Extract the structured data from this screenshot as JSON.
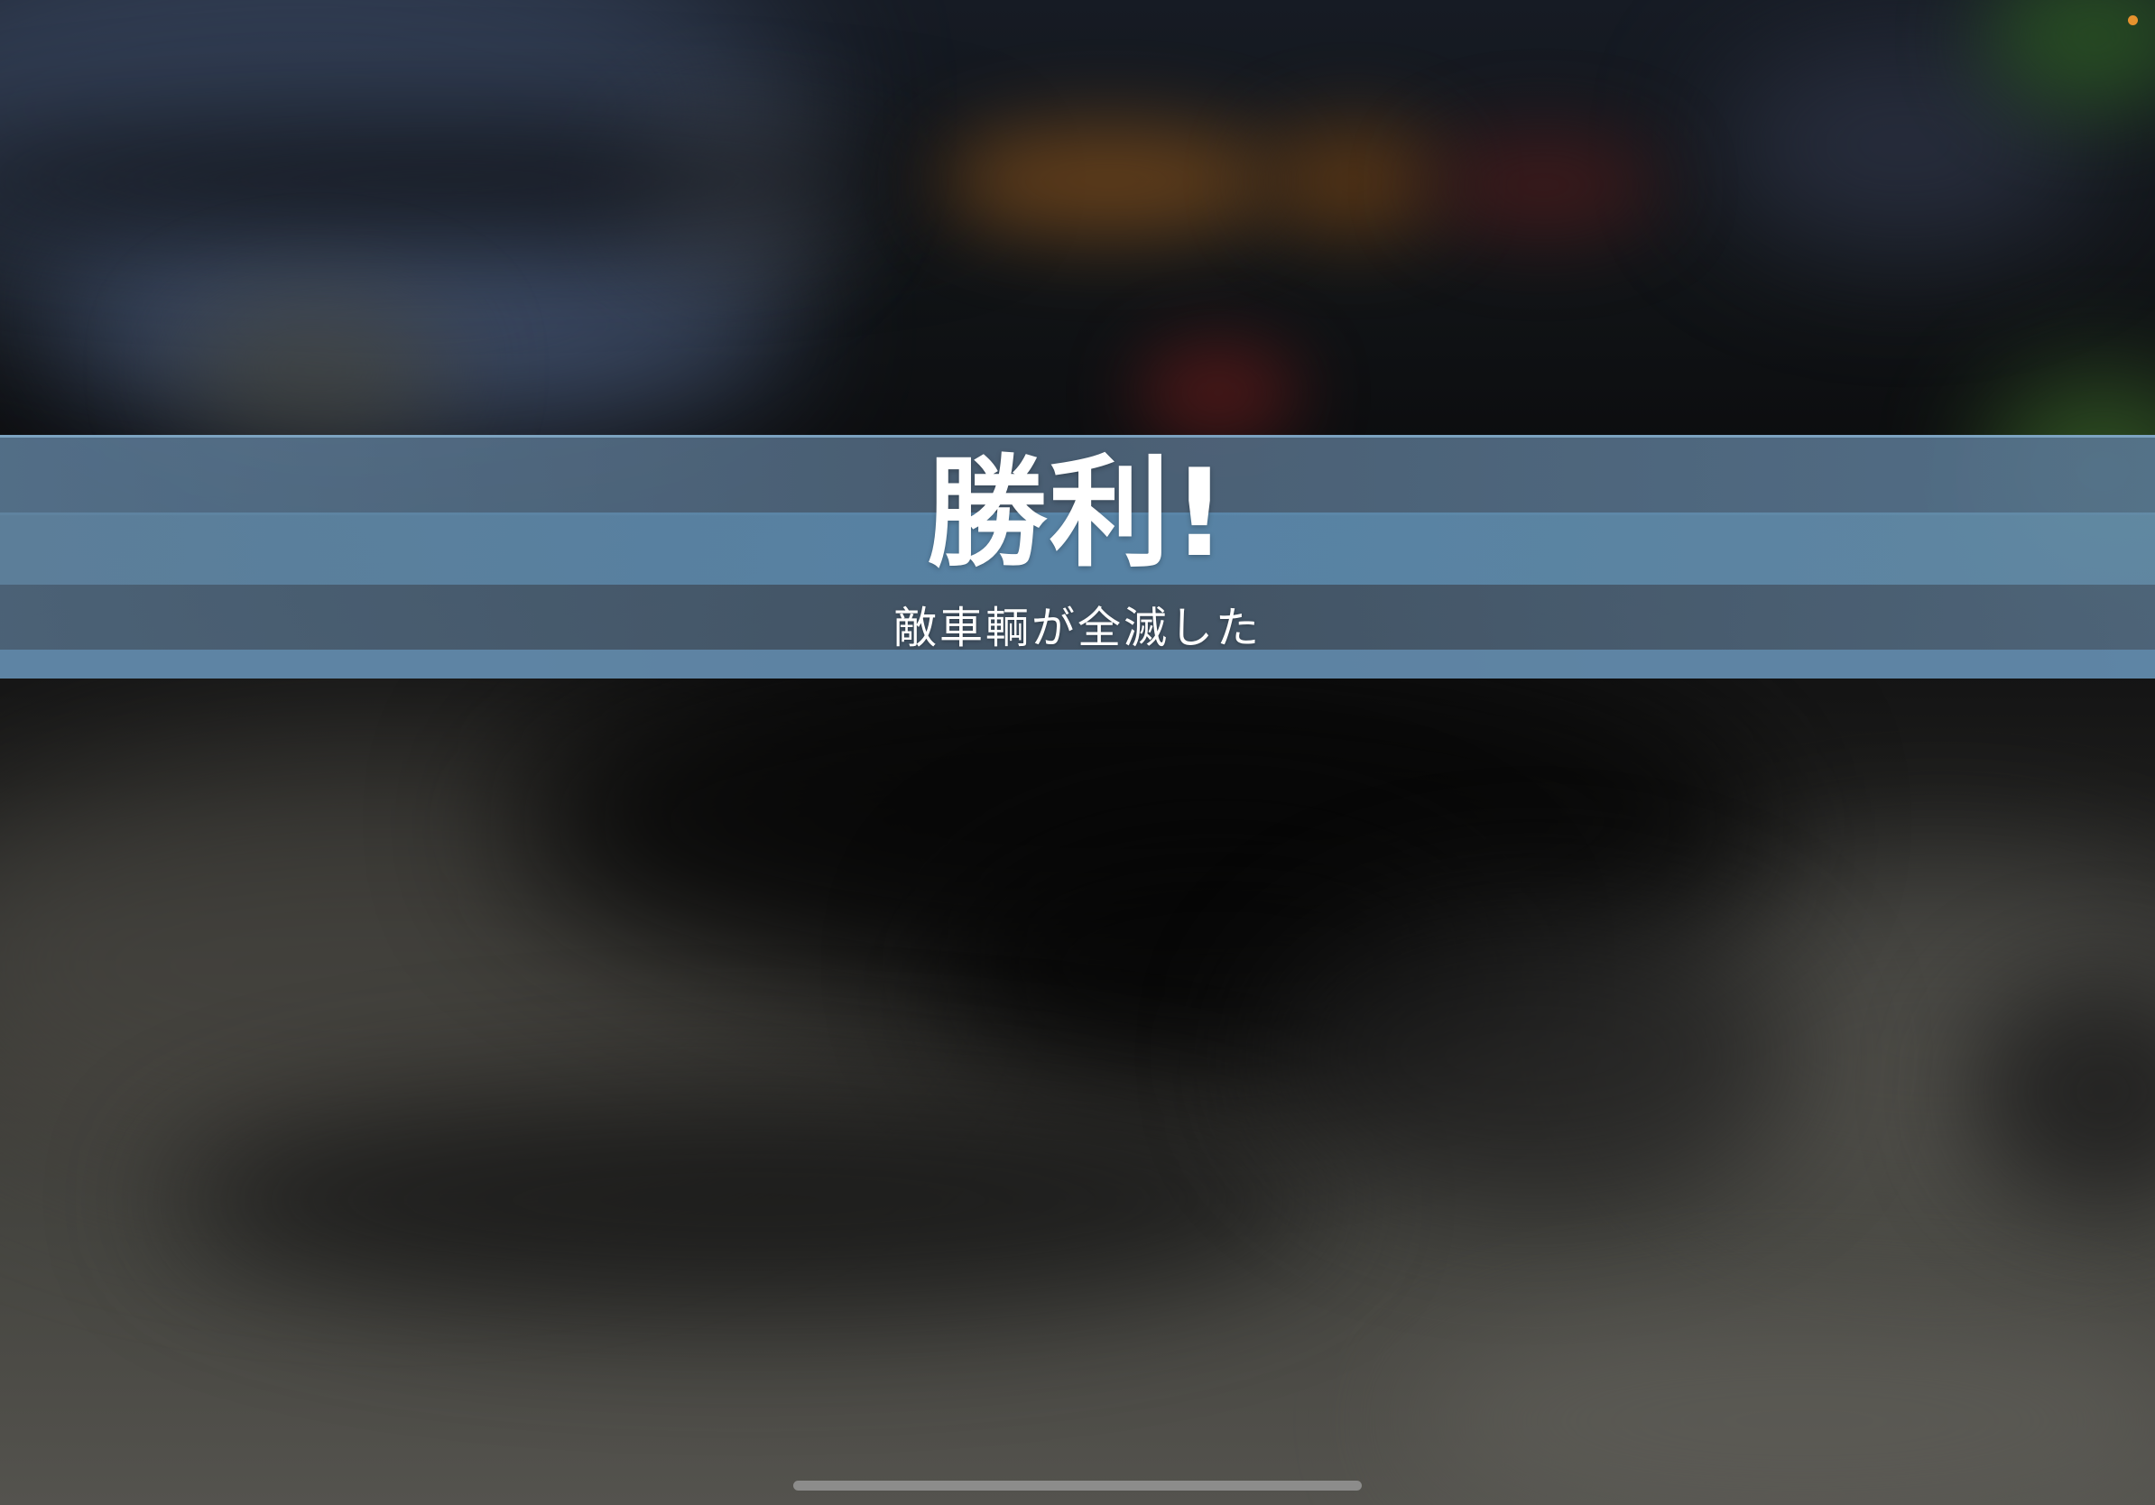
{
  "banner": {
    "title": "勝利!",
    "subtitle": "敵車輌が全滅した"
  },
  "colors": {
    "banner_stripe": "#5a88ac",
    "banner_text": "#ffffff",
    "recording_indicator": "#e6922e",
    "home_indicator": "#969696"
  },
  "icons": {
    "recording_indicator": "dot",
    "home_indicator": "bar"
  }
}
